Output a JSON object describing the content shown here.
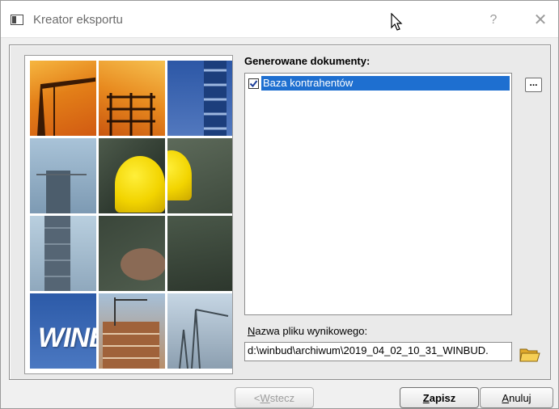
{
  "window": {
    "title": "Kreator eksportu",
    "help_glyph": "?",
    "close_glyph": "✕"
  },
  "image_panel": {
    "logo_text": "WINBUD"
  },
  "documents": {
    "label": "Generowane dokumenty:",
    "items": [
      {
        "label": "Baza kontrahentów",
        "checked": true,
        "selected": true
      }
    ],
    "more_button_label": "..."
  },
  "output_file": {
    "label_prefix": "N",
    "label_rest": "azwa pliku wynikowego:",
    "value": "d:\\winbud\\archiwum\\2019_04_02_10_31_WINBUD."
  },
  "buttons": {
    "back_prefix": "< ",
    "back_accel": "W",
    "back_rest": "stecz",
    "save_accel": "Z",
    "save_rest": "apisz",
    "cancel_accel": "A",
    "cancel_rest": "nuluj"
  },
  "colors": {
    "selection": "#1e6fd0",
    "window_bg": "#f0f0f0"
  },
  "icons": {
    "app": "window-icon",
    "cursor": "mouse-pointer-icon",
    "folder": "open-folder-icon",
    "check": "checkmark-icon"
  }
}
